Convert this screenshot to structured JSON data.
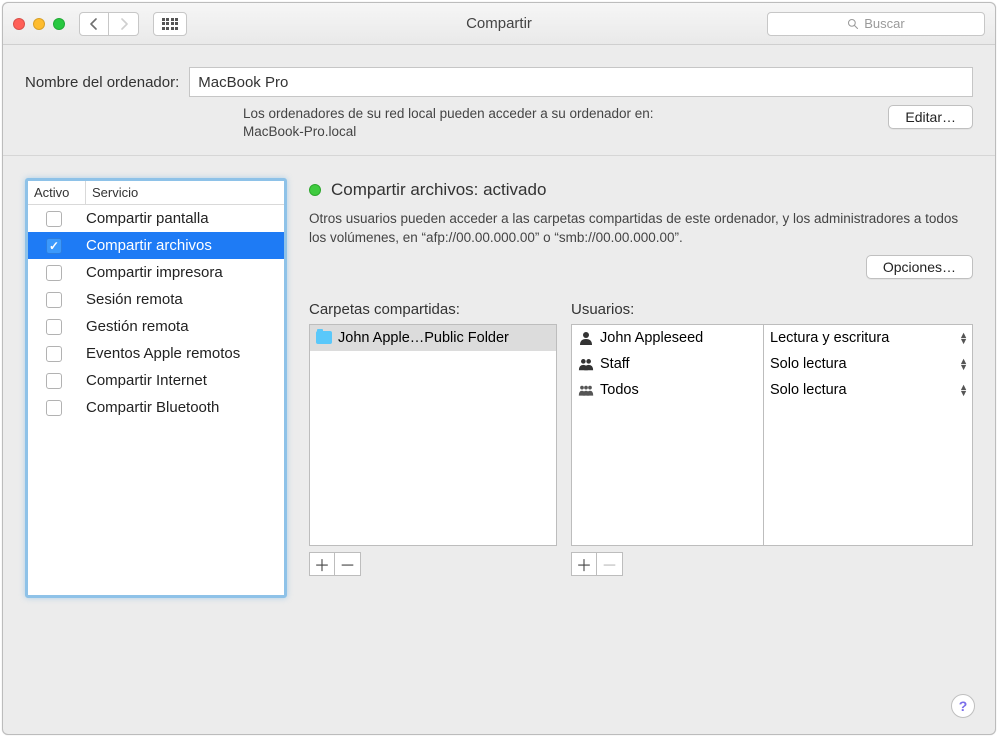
{
  "titlebar": {
    "title": "Compartir",
    "search_placeholder": "Buscar"
  },
  "computer_name": {
    "label": "Nombre del ordenador:",
    "value": "MacBook Pro",
    "description_line1": "Los ordenadores de su red local pueden acceder a su ordenador en:",
    "description_line2": "MacBook-Pro.local",
    "edit_button": "Editar…"
  },
  "services": {
    "header_active": "Activo",
    "header_service": "Servicio",
    "items": [
      {
        "label": "Compartir pantalla",
        "checked": false,
        "selected": false
      },
      {
        "label": "Compartir archivos",
        "checked": true,
        "selected": true
      },
      {
        "label": "Compartir impresora",
        "checked": false,
        "selected": false
      },
      {
        "label": "Sesión remota",
        "checked": false,
        "selected": false
      },
      {
        "label": "Gestión remota",
        "checked": false,
        "selected": false
      },
      {
        "label": "Eventos Apple remotos",
        "checked": false,
        "selected": false
      },
      {
        "label": "Compartir Internet",
        "checked": false,
        "selected": false
      },
      {
        "label": "Compartir Bluetooth",
        "checked": false,
        "selected": false
      }
    ]
  },
  "status": {
    "title": "Compartir archivos: activado",
    "description": "Otros usuarios pueden acceder a las carpetas compartidas de este ordenador, y los administradores a todos los volúmenes, en “afp://00.00.000.00” o “smb://00.00.000.00”.",
    "options_button": "Opciones…"
  },
  "shared_folders": {
    "label": "Carpetas compartidas:",
    "items": [
      {
        "name": "John Apple…Public Folder",
        "selected": true
      }
    ]
  },
  "users": {
    "label": "Usuarios:",
    "items": [
      {
        "name": "John Appleseed",
        "icon": "single"
      },
      {
        "name": "Staff",
        "icon": "double"
      },
      {
        "name": "Todos",
        "icon": "triple"
      }
    ]
  },
  "permissions": {
    "items": [
      "Lectura y escritura",
      "Solo lectura",
      "Solo lectura"
    ]
  },
  "help": "?"
}
